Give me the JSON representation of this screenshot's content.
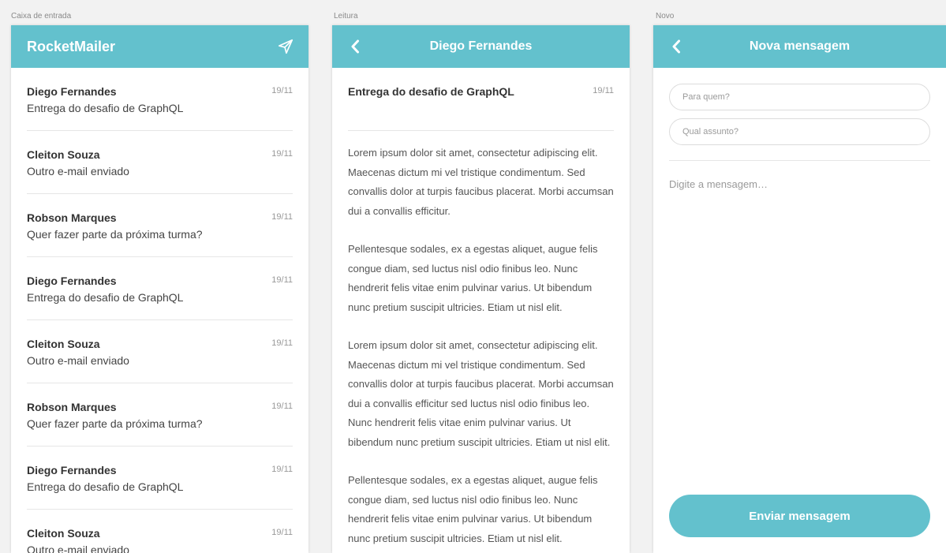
{
  "artboards": {
    "inbox_label": "Caixa de entrada",
    "reader_label": "Leitura",
    "compose_label": "Novo"
  },
  "colors": {
    "accent": "#63c1cd",
    "background": "#f2f2f2"
  },
  "inbox": {
    "app_title": "RocketMailer",
    "compose_icon": "paper-plane-icon",
    "emails": [
      {
        "sender": "Diego Fernandes",
        "subject": "Entrega do desafio de GraphQL",
        "date": "19/11"
      },
      {
        "sender": "Cleiton Souza",
        "subject": "Outro e-mail enviado",
        "date": "19/11"
      },
      {
        "sender": "Robson Marques",
        "subject": "Quer fazer parte da próxima turma?",
        "date": "19/11"
      },
      {
        "sender": "Diego Fernandes",
        "subject": "Entrega do desafio de GraphQL",
        "date": "19/11"
      },
      {
        "sender": "Cleiton Souza",
        "subject": "Outro e-mail enviado",
        "date": "19/11"
      },
      {
        "sender": "Robson Marques",
        "subject": "Quer fazer parte da próxima turma?",
        "date": "19/11"
      },
      {
        "sender": "Diego Fernandes",
        "subject": "Entrega do desafio de GraphQL",
        "date": "19/11"
      },
      {
        "sender": "Cleiton Souza",
        "subject": "Outro e-mail enviado",
        "date": "19/11"
      }
    ]
  },
  "reader": {
    "back_icon": "chevron-left-icon",
    "title": "Diego Fernandes",
    "subject": "Entrega do desafio de GraphQL",
    "date": "19/11",
    "paragraphs": [
      "Lorem ipsum dolor sit amet, consectetur adipiscing elit. Maecenas dictum mi vel tristique condimentum. Sed convallis dolor at turpis faucibus placerat. Morbi accumsan dui a convallis efficitur.",
      "Pellentesque sodales, ex a egestas aliquet, augue felis congue diam, sed luctus nisl odio finibus leo. Nunc hendrerit felis vitae enim pulvinar varius. Ut bibendum nunc pretium suscipit ultricies. Etiam ut nisl elit.",
      "Lorem ipsum dolor sit amet, consectetur adipiscing elit. Maecenas dictum mi vel tristique condimentum. Sed convallis dolor at turpis faucibus placerat. Morbi accumsan dui a convallis efficitur sed luctus nisl odio finibus leo. Nunc hendrerit felis vitae enim pulvinar varius. Ut bibendum nunc pretium suscipit ultricies. Etiam ut nisl elit.",
      "Pellentesque sodales, ex a egestas aliquet, augue felis congue diam, sed luctus nisl odio finibus leo. Nunc hendrerit felis vitae enim pulvinar varius. Ut bibendum nunc pretium suscipit ultricies. Etiam ut nisl elit."
    ]
  },
  "compose": {
    "back_icon": "chevron-left-icon",
    "title": "Nova mensagem",
    "to_placeholder": "Para quem?",
    "to_value": "",
    "subject_placeholder": "Qual assunto?",
    "subject_value": "",
    "message_placeholder": "Digite a mensagem…",
    "message_value": "",
    "send_label": "Enviar mensagem"
  }
}
